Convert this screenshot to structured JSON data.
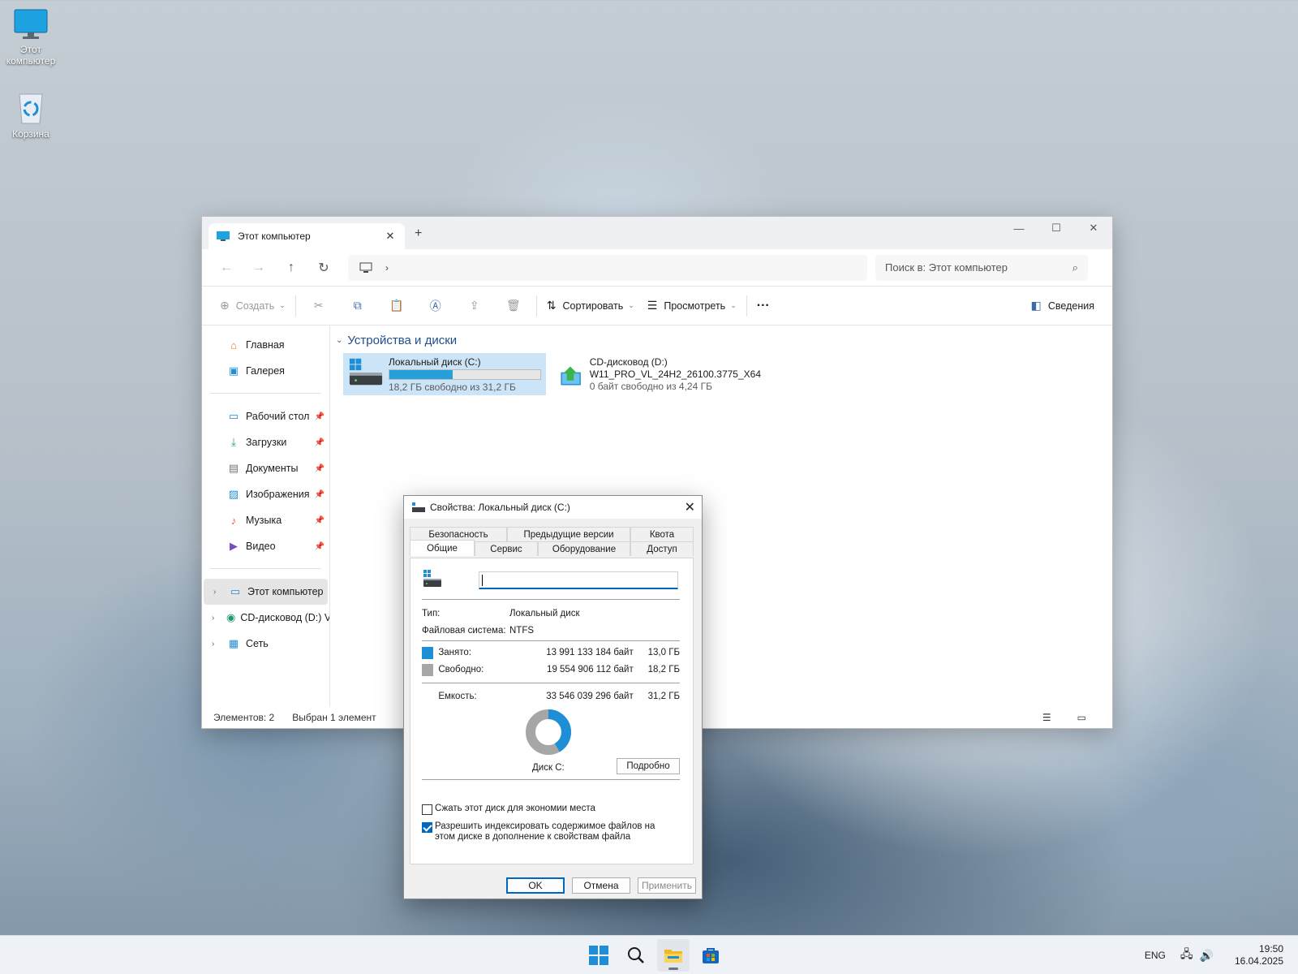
{
  "desktop": {
    "icons": [
      {
        "label": "Этот компьютер",
        "icon": "monitor-icon"
      },
      {
        "label": "Корзина",
        "icon": "recycle-bin-icon"
      }
    ]
  },
  "explorer": {
    "tab_title": "Этот компьютер",
    "search_placeholder": "Поиск в: Этот компьютер",
    "toolbar": {
      "create": "Создать",
      "sort": "Сортировать",
      "view": "Просмотреть",
      "more": "···",
      "details": "Сведения"
    },
    "nav": {
      "home": "Главная",
      "gallery": "Галерея",
      "pinned": [
        "Рабочий стол",
        "Загрузки",
        "Документы",
        "Изображения",
        "Музыка",
        "Видео"
      ],
      "this_pc": "Этот компьютер",
      "cd_drive": "CD-дисковод (D:) V",
      "network": "Сеть"
    },
    "group_title": "Устройства и диски",
    "drives": [
      {
        "name": "Локальный диск (C:)",
        "free_text": "18,2 ГБ свободно из 31,2 ГБ",
        "used_fraction": 0.42
      },
      {
        "name": "CD-дисковод (D:)",
        "volume": "W11_PRO_VL_24H2_26100.3775_X64",
        "free_text": "0 байт свободно из 4,24 ГБ"
      }
    ],
    "status": {
      "count": "Элементов: 2",
      "selected": "Выбран 1 элемент"
    }
  },
  "dialog": {
    "title": "Свойства: Локальный диск (C:)",
    "tabs_row1": [
      "Безопасность",
      "Предыдущие версии",
      "Квота"
    ],
    "tabs_row2": [
      "Общие",
      "Сервис",
      "Оборудование",
      "Доступ"
    ],
    "type_label": "Тип:",
    "type_value": "Локальный диск",
    "fs_label": "Файловая система:",
    "fs_value": "NTFS",
    "used_label": "Занято:",
    "used_bytes": "13 991 133 184 байт",
    "used_gb": "13,0 ГБ",
    "free_label": "Свободно:",
    "free_bytes": "19 554 906 112 байт",
    "free_gb": "18,2 ГБ",
    "capacity_label": "Емкость:",
    "capacity_bytes": "33 546 039 296 байт",
    "capacity_gb": "31,2 ГБ",
    "used_fraction": 0.417,
    "used_color": "#1e8fd6",
    "free_color": "#a6a6a6",
    "disk_label": "Диск C:",
    "details_button": "Подробно",
    "compress_label": "Сжать этот диск для экономии места",
    "index_label": "Разрешить индексировать содержимое файлов на этом диске в дополнение к свойствам файла",
    "compress_checked": false,
    "index_checked": true,
    "ok": "OK",
    "cancel": "Отмена",
    "apply": "Применить"
  },
  "taskbar": {
    "lang": "ENG",
    "time": "19:50",
    "date": "16.04.2025"
  }
}
